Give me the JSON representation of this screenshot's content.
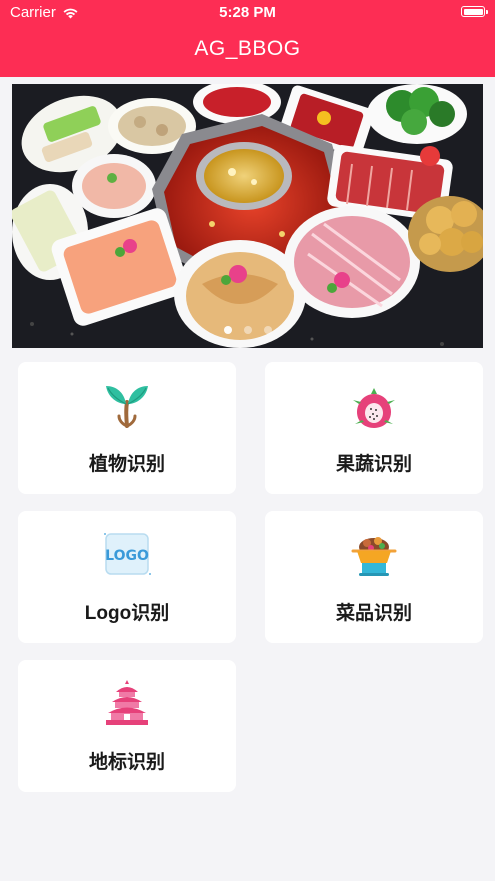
{
  "status_bar": {
    "carrier": "Carrier",
    "time": "5:28 PM"
  },
  "nav": {
    "title": "AG_BBOG"
  },
  "banner": {
    "image_desc": "hot-pot-food-platter",
    "dots": 3,
    "active_dot": 0
  },
  "cards": [
    {
      "label": "植物识别",
      "icon": "plant-sprout-icon"
    },
    {
      "label": "果蔬识别",
      "icon": "dragon-fruit-icon"
    },
    {
      "label": "Logo识别",
      "icon": "logo-badge-icon"
    },
    {
      "label": "菜品识别",
      "icon": "hot-pot-dish-icon"
    },
    {
      "label": "地标识别",
      "icon": "temple-landmark-icon"
    }
  ],
  "colors": {
    "brand": "#fd2d54",
    "background": "#f4f4f7",
    "card": "#ffffff"
  }
}
